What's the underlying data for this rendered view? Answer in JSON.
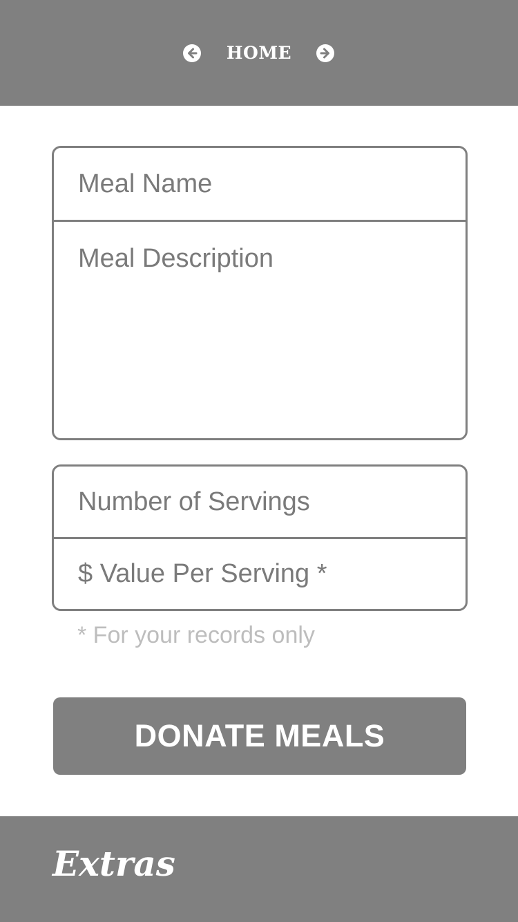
{
  "header": {
    "title": "HOME",
    "back_icon": "arrow-circle-left-icon",
    "forward_icon": "arrow-circle-right-icon",
    "background_color": "#808080"
  },
  "meal_form": {
    "meal_name_placeholder": "Meal Name",
    "meal_description_placeholder": "Meal Description",
    "servings_placeholder": "Number of Servings",
    "value_per_serving_placeholder": "$ Value Per Serving *",
    "note": "* For your records only"
  },
  "actions": {
    "donate_label": "DONATE MEALS"
  },
  "footer": {
    "logo_text": "Extras"
  },
  "colors": {
    "accent_gray": "#808080",
    "border_gray": "#7f7f7f",
    "note_gray": "#bdbdbd"
  }
}
